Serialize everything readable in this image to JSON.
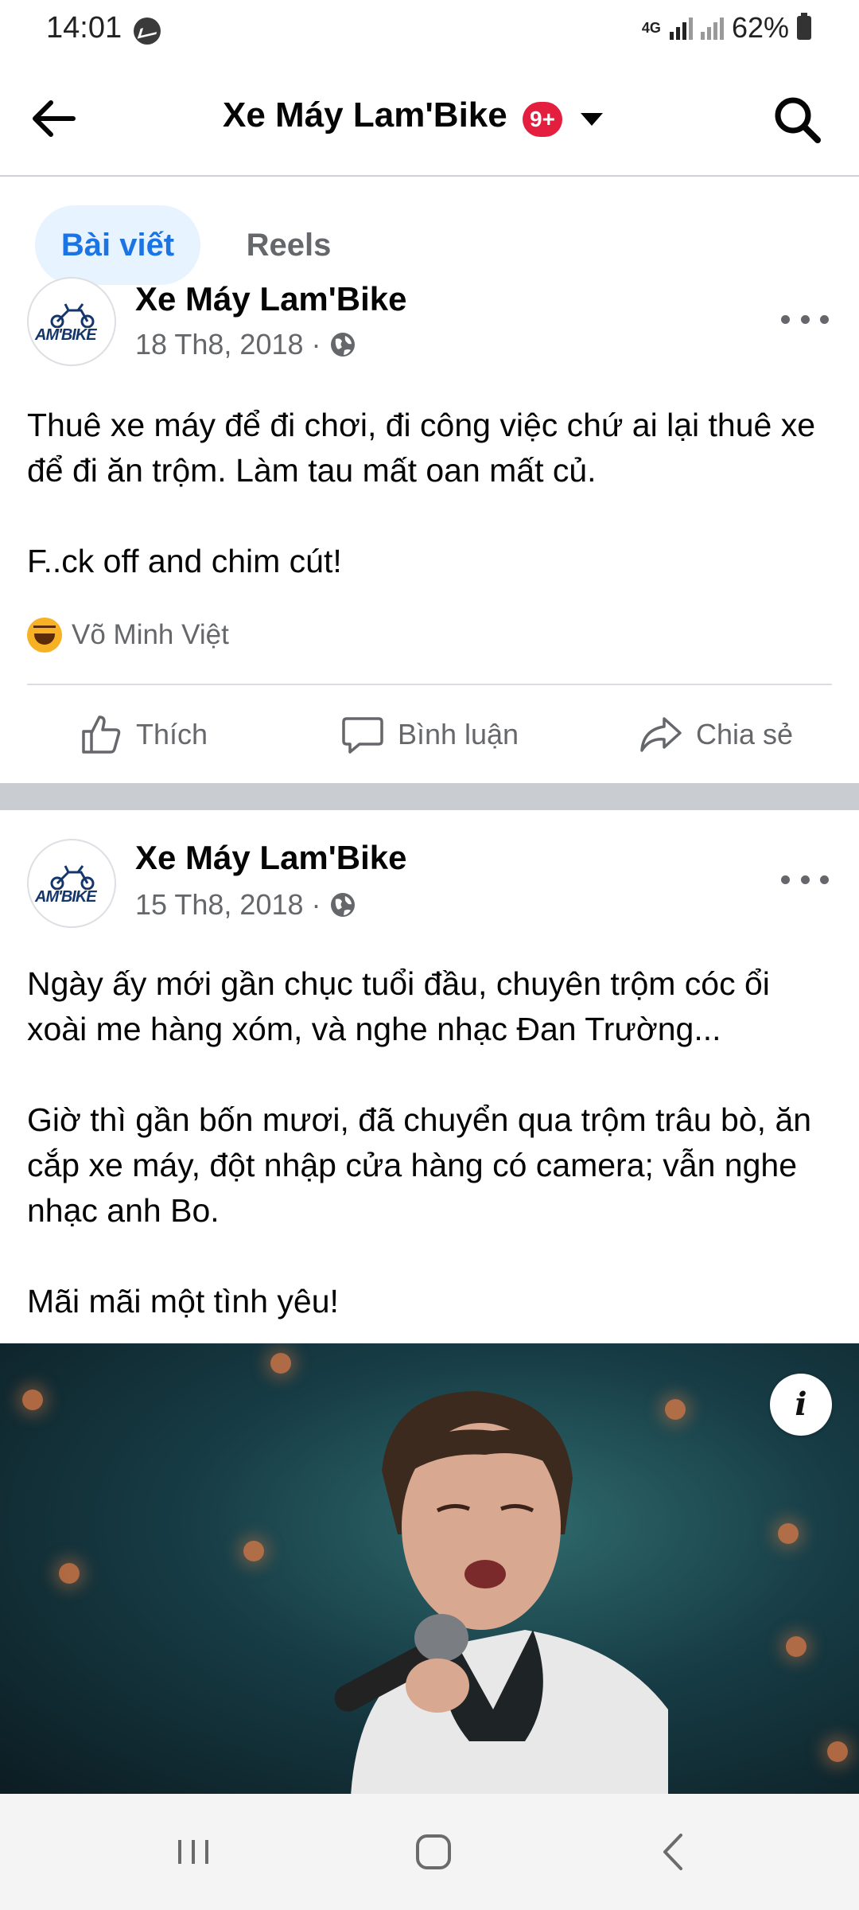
{
  "status_bar": {
    "time": "14:01",
    "network": "4G",
    "battery": "62%"
  },
  "header": {
    "title": "Xe Máy Lam'Bike",
    "badge": "9+",
    "icons": [
      "back-arrow-icon",
      "chevron-down-icon",
      "search-icon"
    ]
  },
  "tabs": [
    {
      "label": "Bài viết",
      "active": true
    },
    {
      "label": "Reels",
      "active": false
    }
  ],
  "posts": [
    {
      "page_name": "Xe Máy Lam'Bike",
      "date": "18 Th8, 2018",
      "privacy_icon": "globe-icon",
      "text": "Thuê xe máy để đi chơi, đi công việc chứ ai lại thuê xe để đi ăn trộm. Làm tau mất oan mất củ.\n\nF..ck off and chim cút!",
      "reaction_icon": "haha-icon",
      "reaction_by": "Võ Minh Việt",
      "actions": [
        {
          "label": "Thích",
          "icon": "like-icon"
        },
        {
          "label": "Bình luận",
          "icon": "comment-icon"
        },
        {
          "label": "Chia sẻ",
          "icon": "share-icon"
        }
      ]
    },
    {
      "page_name": "Xe Máy Lam'Bike",
      "date": "15 Th8, 2018",
      "privacy_icon": "globe-icon",
      "text": "Ngày ấy mới gần chục tuổi đầu, chuyên trộm cóc ổi xoài me hàng xóm, và nghe nhạc Đan Trường...\n\nGiờ thì gần bốn mươi, đã chuyển qua trộm trâu bò, ăn cắp xe máy, đột nhập cửa hàng có camera; vẫn nghe nhạc anh Bo.\n\nMãi mãi một tình yêu!",
      "image_icon": "info-icon",
      "image_info_glyph": "i"
    }
  ],
  "avatar_logo": "AM'BIKE",
  "nav_bar": {
    "icons": [
      "recent-apps-icon",
      "home-icon",
      "back-icon"
    ]
  },
  "colors": {
    "accent": "#1b74e4",
    "tab_active_bg": "#e7f3ff",
    "badge": "#e41e3f",
    "secondary_text": "#65676b",
    "separator": "#c9ccd1"
  }
}
